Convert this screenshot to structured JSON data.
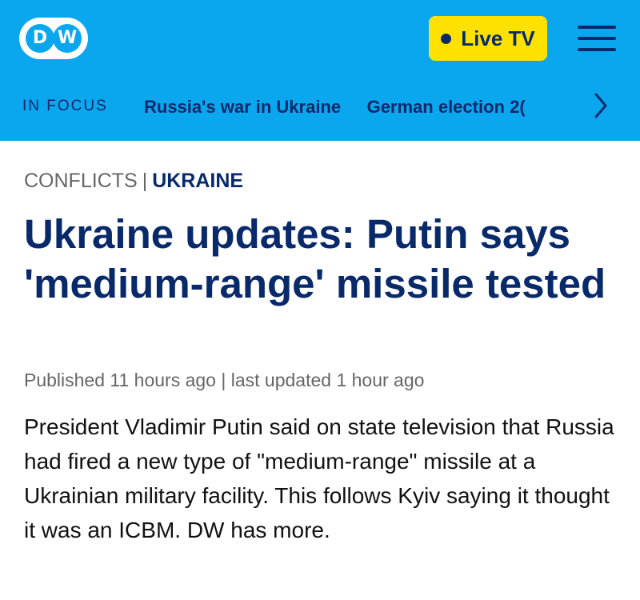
{
  "header": {
    "logo_text": "DW",
    "live_label": "Live TV",
    "background_color": "#0aa6ee",
    "accent_color": "#ffe100",
    "navy_color": "#082a6b",
    "menu_icon": "hamburger-menu-icon"
  },
  "focus_bar": {
    "label": "IN FOCUS",
    "links": [
      "Russia's war in Ukraine",
      "German election 2("
    ],
    "next_icon": "chevron-right-icon"
  },
  "article": {
    "category": "CONFLICTS",
    "separator": "|",
    "subcategory": "UKRAINE",
    "headline": "Ukraine updates: Putin says 'medium-range' missile tested",
    "published": "Published 11 hours ago | last updated 1 hour ago",
    "lede": "President Vladimir Putin said on state television that Russia had fired a new type of \"medium-range\" missile at a Ukrainian military facility. This follows Kyiv saying it thought it was an ICBM. DW has more."
  }
}
